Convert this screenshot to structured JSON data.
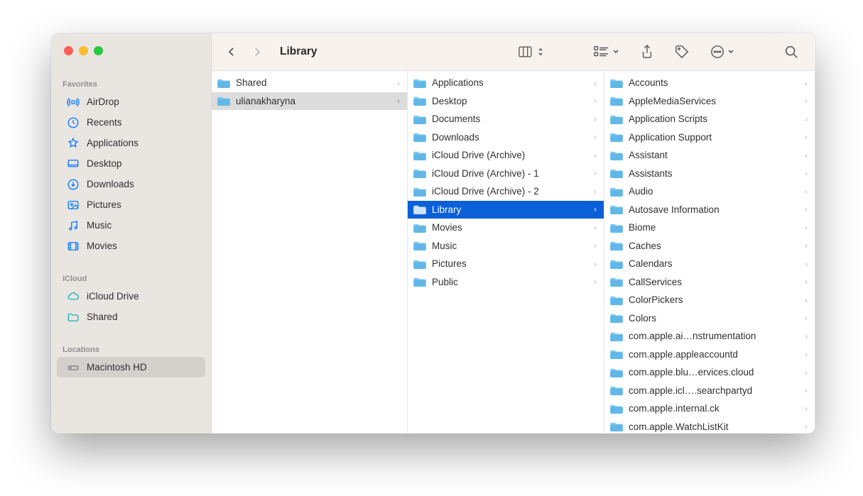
{
  "window_title": "Library",
  "sidebar": {
    "sections": [
      {
        "label": "Favorites",
        "items": [
          {
            "icon": "airdrop",
            "label": "AirDrop"
          },
          {
            "icon": "recents",
            "label": "Recents"
          },
          {
            "icon": "applications",
            "label": "Applications"
          },
          {
            "icon": "desktop",
            "label": "Desktop"
          },
          {
            "icon": "downloads",
            "label": "Downloads"
          },
          {
            "icon": "pictures",
            "label": "Pictures"
          },
          {
            "icon": "music",
            "label": "Music"
          },
          {
            "icon": "movies",
            "label": "Movies"
          }
        ]
      },
      {
        "label": "iCloud",
        "items": [
          {
            "icon": "icloud",
            "label": "iCloud Drive"
          },
          {
            "icon": "shared",
            "label": "Shared"
          }
        ]
      },
      {
        "label": "Locations",
        "items": [
          {
            "icon": "hdd",
            "label": "Macintosh HD",
            "selected": true,
            "gray": true
          }
        ]
      }
    ]
  },
  "columns": [
    {
      "items": [
        {
          "label": "Shared",
          "hasChildren": true
        },
        {
          "label": "ulianakharyna",
          "hasChildren": true,
          "selected": "light"
        }
      ]
    },
    {
      "items": [
        {
          "label": "Applications",
          "hasChildren": true
        },
        {
          "label": "Desktop",
          "hasChildren": true
        },
        {
          "label": "Documents",
          "hasChildren": true
        },
        {
          "label": "Downloads",
          "hasChildren": true
        },
        {
          "label": "iCloud Drive (Archive)",
          "hasChildren": true
        },
        {
          "label": "iCloud Drive (Archive) - 1",
          "hasChildren": true
        },
        {
          "label": "iCloud Drive (Archive) - 2",
          "hasChildren": true
        },
        {
          "label": "Library",
          "hasChildren": true,
          "selected": "blue"
        },
        {
          "label": "Movies",
          "hasChildren": true
        },
        {
          "label": "Music",
          "hasChildren": true
        },
        {
          "label": "Pictures",
          "hasChildren": true
        },
        {
          "label": "Public",
          "hasChildren": true
        }
      ]
    },
    {
      "items": [
        {
          "label": "Accounts",
          "hasChildren": true
        },
        {
          "label": "AppleMediaServices",
          "hasChildren": true
        },
        {
          "label": "Application Scripts",
          "hasChildren": true
        },
        {
          "label": "Application Support",
          "hasChildren": true
        },
        {
          "label": "Assistant",
          "hasChildren": true
        },
        {
          "label": "Assistants",
          "hasChildren": true
        },
        {
          "label": "Audio",
          "hasChildren": true
        },
        {
          "label": "Autosave Information",
          "hasChildren": true
        },
        {
          "label": "Biome",
          "hasChildren": true
        },
        {
          "label": "Caches",
          "hasChildren": true
        },
        {
          "label": "Calendars",
          "hasChildren": true
        },
        {
          "label": "CallServices",
          "hasChildren": true
        },
        {
          "label": "ColorPickers",
          "hasChildren": true
        },
        {
          "label": "Colors",
          "hasChildren": true
        },
        {
          "label": "com.apple.ai…nstrumentation",
          "hasChildren": true
        },
        {
          "label": "com.apple.appleaccountd",
          "hasChildren": true
        },
        {
          "label": "com.apple.blu…ervices.cloud",
          "hasChildren": true
        },
        {
          "label": "com.apple.icl….searchpartyd",
          "hasChildren": true
        },
        {
          "label": "com.apple.internal.ck",
          "hasChildren": true
        },
        {
          "label": "com.apple.WatchListKit",
          "hasChildren": true
        }
      ]
    }
  ]
}
